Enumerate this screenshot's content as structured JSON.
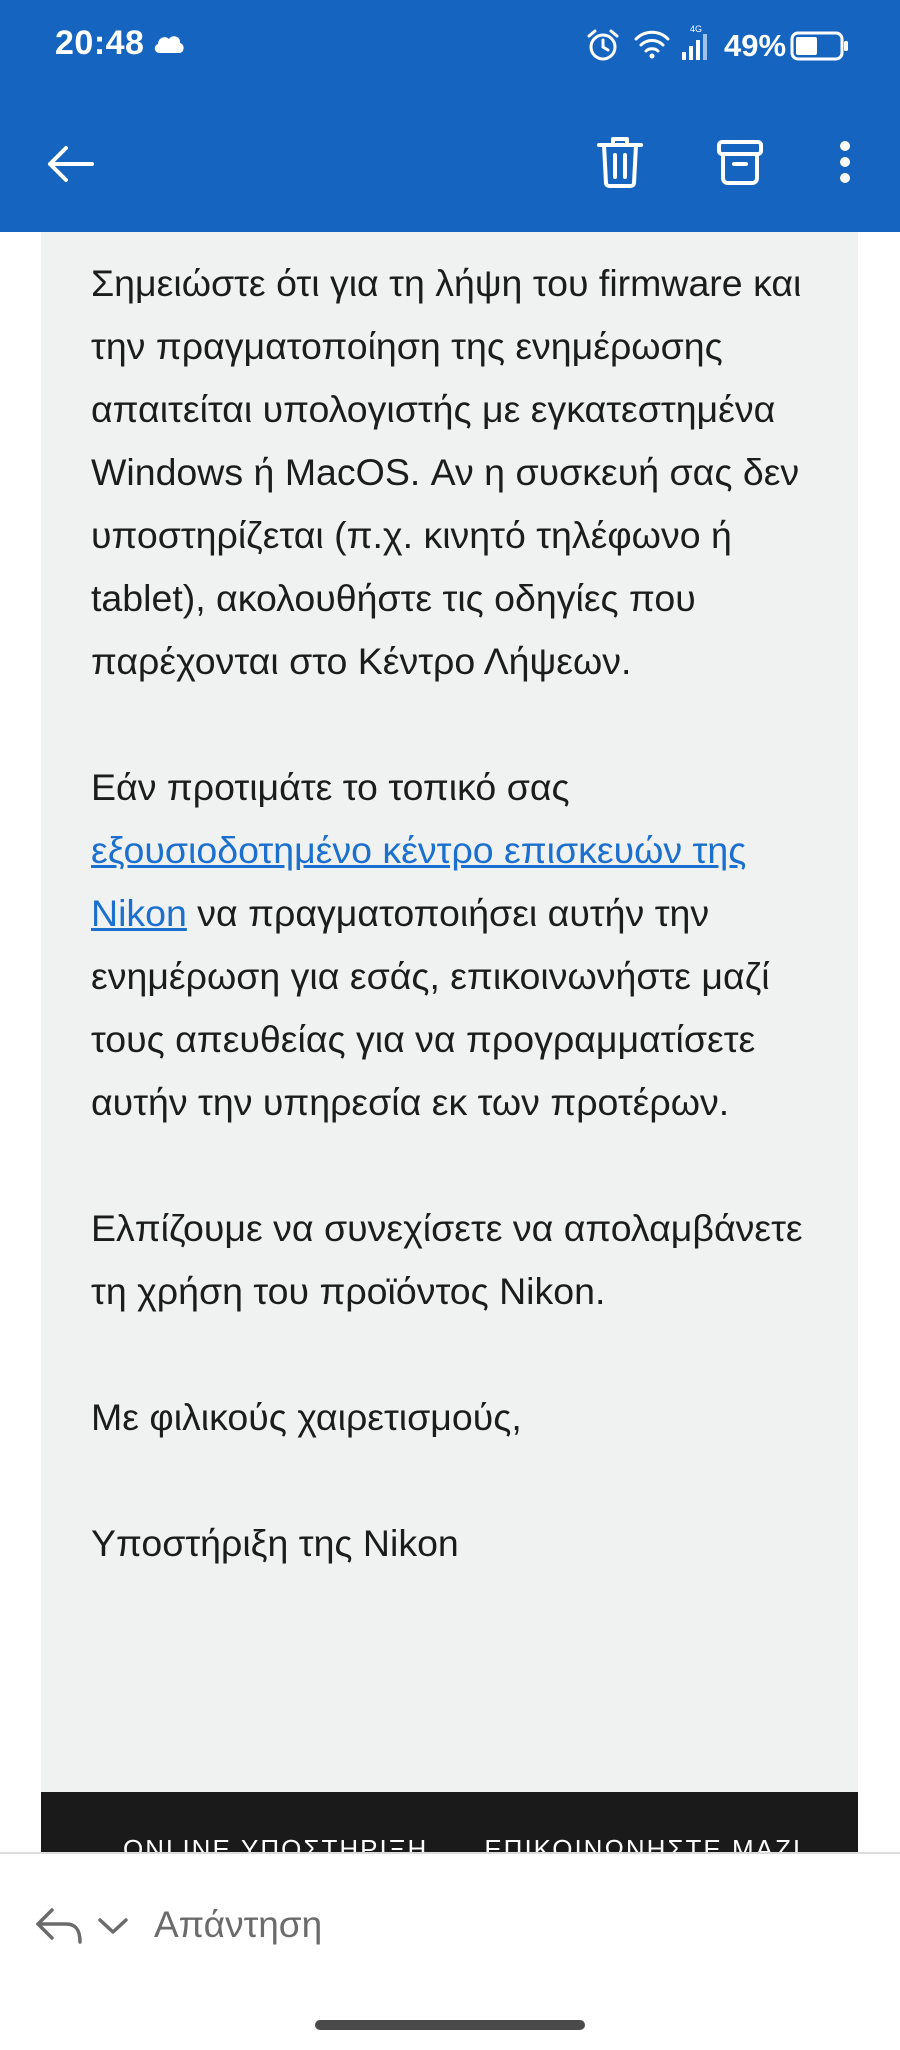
{
  "status_bar": {
    "time": "20:48",
    "network_label": "4G",
    "battery_percent": "49%",
    "icons": [
      "cloud-icon",
      "alarm-icon",
      "wifi-icon",
      "signal-icon",
      "battery-icon"
    ]
  },
  "app_bar": {
    "icons": [
      "back-arrow-icon",
      "trash-icon",
      "archive-icon",
      "more-vertical-icon"
    ],
    "accent_color": "#1565c0"
  },
  "email": {
    "paragraph1": "Σημειώστε ότι για τη λήψη του firmware και την πραγματοποίηση της ενημέρωσης απαιτείται υπολογιστής με εγκατεστημένα Windows ή MacOS. Αν η συσκευή σας δεν υποστηρίζεται (π.χ. κινητό τηλέφωνο ή tablet), ακολουθήστε τις οδηγίες που παρέχονται στο Κέντρο Λήψεων.",
    "paragraph2_before": "Εάν προτιμάτε το τοπικό σας ",
    "paragraph2_link": "εξουσιοδοτημένο κέντρο επισκευών της Nikon",
    "paragraph2_after": " να πραγματοποιήσει αυτήν την ενημέρωση για εσάς, επικοινωνήστε μαζί τους απευθείας για να προγραμματίσετε αυτήν την υπηρεσία εκ των προτέρων.",
    "paragraph3": "Ελπίζουμε να συνεχίσετε να απολαμβάνετε τη χρήση του προϊόντος Nikon.",
    "closing": "Με φιλικούς χαιρετισμούς,",
    "signature": "Υποστήριξη της Nikon",
    "link_color": "#1a6fcf"
  },
  "footer": {
    "link1": "ONLINE ΥΠΟΣΤΗΡΙΞΗ",
    "link2": "ΕΠΙΚΟΙΝΩΝΗΣΤΕ ΜΑΖΙ"
  },
  "reply_bar": {
    "reply_label": "Απάντηση",
    "icons": [
      "reply-icon",
      "chevron-down-icon"
    ]
  }
}
